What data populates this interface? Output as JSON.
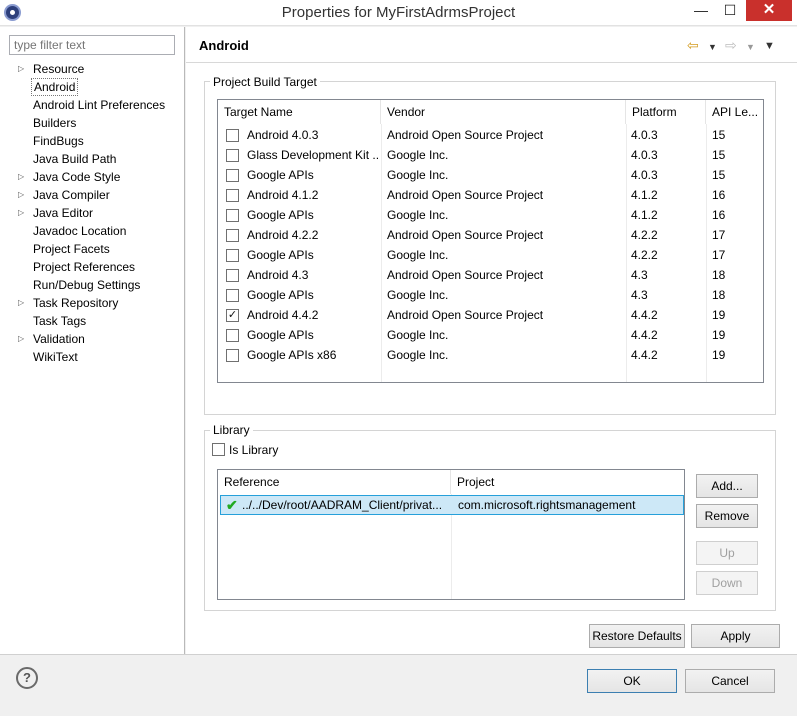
{
  "window": {
    "title": "Properties for MyFirstAdrmsProject",
    "minimize_glyph": "—",
    "maximize_glyph": "☐",
    "close_glyph": "✕"
  },
  "filter": {
    "placeholder": "type filter text"
  },
  "nav": [
    {
      "label": "Resource",
      "expandable": true
    },
    {
      "label": "Android",
      "expandable": false,
      "selected": true
    },
    {
      "label": "Android Lint Preferences",
      "expandable": false
    },
    {
      "label": "Builders",
      "expandable": false
    },
    {
      "label": "FindBugs",
      "expandable": false
    },
    {
      "label": "Java Build Path",
      "expandable": false
    },
    {
      "label": "Java Code Style",
      "expandable": true
    },
    {
      "label": "Java Compiler",
      "expandable": true
    },
    {
      "label": "Java Editor",
      "expandable": true
    },
    {
      "label": "Javadoc Location",
      "expandable": false
    },
    {
      "label": "Project Facets",
      "expandable": false
    },
    {
      "label": "Project References",
      "expandable": false
    },
    {
      "label": "Run/Debug Settings",
      "expandable": false
    },
    {
      "label": "Task Repository",
      "expandable": true
    },
    {
      "label": "Task Tags",
      "expandable": false
    },
    {
      "label": "Validation",
      "expandable": true
    },
    {
      "label": "WikiText",
      "expandable": false
    }
  ],
  "page": {
    "title": "Android",
    "back_icon": "back-arrow-icon",
    "forward_icon": "forward-arrow-icon",
    "menu_icon": "view-menu-icon"
  },
  "build_target": {
    "group_label": "Project Build Target",
    "columns": [
      "Target Name",
      "Vendor",
      "Platform",
      "API Le..."
    ],
    "rows": [
      {
        "name": "Android 4.0.3",
        "vendor": "Android Open Source Project",
        "platform": "4.0.3",
        "api": "15",
        "checked": false
      },
      {
        "name": "Glass Development Kit ...",
        "vendor": "Google Inc.",
        "platform": "4.0.3",
        "api": "15",
        "checked": false
      },
      {
        "name": "Google APIs",
        "vendor": "Google Inc.",
        "platform": "4.0.3",
        "api": "15",
        "checked": false
      },
      {
        "name": "Android 4.1.2",
        "vendor": "Android Open Source Project",
        "platform": "4.1.2",
        "api": "16",
        "checked": false
      },
      {
        "name": "Google APIs",
        "vendor": "Google Inc.",
        "platform": "4.1.2",
        "api": "16",
        "checked": false
      },
      {
        "name": "Android 4.2.2",
        "vendor": "Android Open Source Project",
        "platform": "4.2.2",
        "api": "17",
        "checked": false
      },
      {
        "name": "Google APIs",
        "vendor": "Google Inc.",
        "platform": "4.2.2",
        "api": "17",
        "checked": false
      },
      {
        "name": "Android 4.3",
        "vendor": "Android Open Source Project",
        "platform": "4.3",
        "api": "18",
        "checked": false
      },
      {
        "name": "Google APIs",
        "vendor": "Google Inc.",
        "platform": "4.3",
        "api": "18",
        "checked": false
      },
      {
        "name": "Android 4.4.2",
        "vendor": "Android Open Source Project",
        "platform": "4.4.2",
        "api": "19",
        "checked": true
      },
      {
        "name": "Google APIs",
        "vendor": "Google Inc.",
        "platform": "4.4.2",
        "api": "19",
        "checked": false
      },
      {
        "name": "Google APIs x86",
        "vendor": "Google Inc.",
        "platform": "4.4.2",
        "api": "19",
        "checked": false
      }
    ]
  },
  "library": {
    "group_label": "Library",
    "is_library_label": "Is Library",
    "is_library_checked": false,
    "columns": [
      "Reference",
      "Project"
    ],
    "rows": [
      {
        "reference": "../../Dev/root/AADRAM_Client/privat...",
        "project": "com.microsoft.rightsmanagement",
        "status_icon": "check-icon",
        "status_color": "#22aa22"
      }
    ],
    "buttons": {
      "add": "Add...",
      "remove": "Remove",
      "up": "Up",
      "down": "Down"
    }
  },
  "footer": {
    "restore_defaults": "Restore Defaults",
    "apply": "Apply",
    "ok": "OK",
    "cancel": "Cancel",
    "help_glyph": "?"
  },
  "colors": {
    "selection_bg": "#cde8f7",
    "selection_border": "#26a0da",
    "check_green": "#22aa22"
  }
}
